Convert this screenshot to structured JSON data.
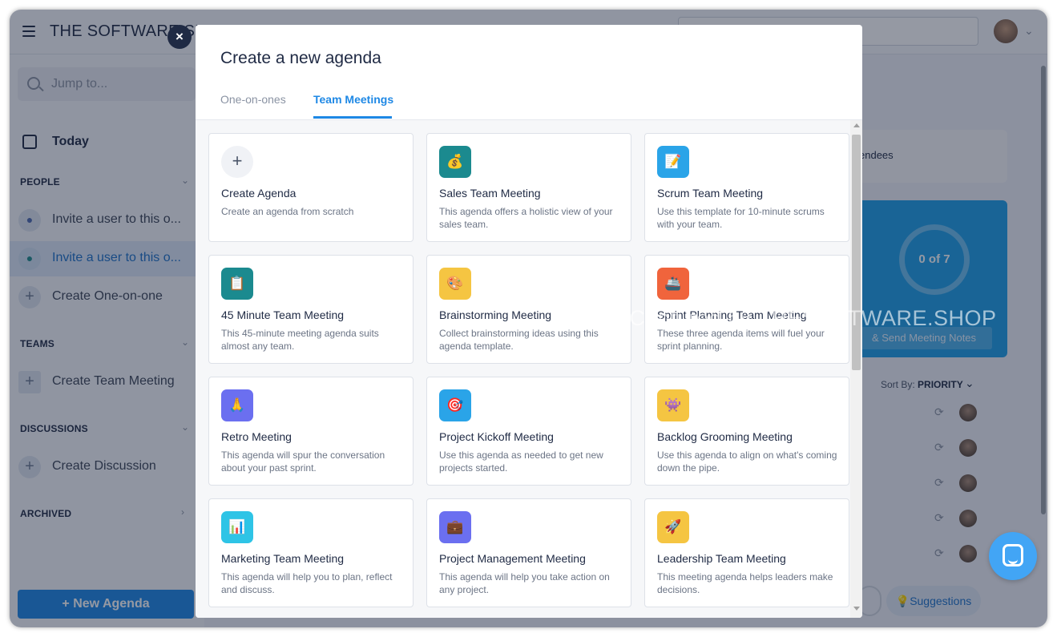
{
  "app": {
    "brand": "THE SOFTWARE SHO",
    "jump_placeholder": "Jump to...",
    "today": "Today",
    "sections": {
      "people": "PEOPLE",
      "teams": "TEAMS",
      "discussions": "DISCUSSIONS",
      "archived": "ARCHIVED"
    },
    "people_items": [
      "Invite a user to this o...",
      "Invite a user to this o..."
    ],
    "create_one_on_one": "Create One-on-one",
    "create_team_meeting": "Create Team Meeting",
    "create_discussion": "Create Discussion",
    "new_agenda": "New Agenda",
    "attendees": "endees",
    "progress": "0 of 7",
    "send_notes": "& Send Meeting Notes",
    "sort_by_label": "Sort By:",
    "sort_by_value": "PRIORITY",
    "suggestions": "Suggestions"
  },
  "modal": {
    "title": "Create a new agenda",
    "close": "×",
    "tabs": [
      {
        "label": "One-on-ones",
        "active": false
      },
      {
        "label": "Team Meetings",
        "active": true
      }
    ],
    "templates": [
      {
        "title": "Create Agenda",
        "desc": "Create an agenda from scratch",
        "icon": "plus-icon",
        "glyph": "+",
        "color": "#f0f2f6"
      },
      {
        "title": "Sales Team Meeting",
        "desc": "This agenda offers a holistic view of your sales team.",
        "icon": "money-bag-icon",
        "glyph": "💰",
        "color": "#1b8a8f"
      },
      {
        "title": "Scrum Team Meeting",
        "desc": "Use this template for 10-minute scrums with your team.",
        "icon": "memo-icon",
        "glyph": "📝",
        "color": "#2aa4e8"
      },
      {
        "title": "45 Minute Team Meeting",
        "desc": "This 45-minute meeting agenda suits almost any team.",
        "icon": "clipboard-icon",
        "glyph": "📋",
        "color": "#1b8a8f"
      },
      {
        "title": "Brainstorming Meeting",
        "desc": "Collect brainstorming ideas using this agenda template.",
        "icon": "palette-icon",
        "glyph": "🎨",
        "color": "#f5c542"
      },
      {
        "title": "Sprint Planning Team Meeting",
        "desc": "These three agenda items will fuel your sprint planning.",
        "icon": "ship-icon",
        "glyph": "🚢",
        "color": "#f0643c"
      },
      {
        "title": "Retro Meeting",
        "desc": "This agenda will spur the conversation about your past sprint.",
        "icon": "pray-icon",
        "glyph": "🙏",
        "color": "#6b6ff0"
      },
      {
        "title": "Project Kickoff Meeting",
        "desc": "Use this agenda as needed to get new projects started.",
        "icon": "target-icon",
        "glyph": "🎯",
        "color": "#2aa4e8"
      },
      {
        "title": "Backlog Grooming Meeting",
        "desc": "Use this agenda to align on what's coming down the pipe.",
        "icon": "alien-monster-icon",
        "glyph": "👾",
        "color": "#f5c542"
      },
      {
        "title": "Marketing Team Meeting",
        "desc": "This agenda will help you to plan, reflect and discuss.",
        "icon": "bar-chart-icon",
        "glyph": "📊",
        "color": "#2ec4e6"
      },
      {
        "title": "Project Management Meeting",
        "desc": "This agenda will help you take action on any project.",
        "icon": "briefcase-icon",
        "glyph": "💼",
        "color": "#6b6ff0"
      },
      {
        "title": "Leadership Team Meeting",
        "desc": "This meeting agenda helps leaders make decisions.",
        "icon": "rocket-icon",
        "glyph": "🚀",
        "color": "#f5c542"
      }
    ]
  },
  "watermark": "© Captured by THESOFTWARE.SHOP",
  "colors": {
    "accent": "#1e88e5",
    "overlay": "rgba(20,28,50,.45)"
  }
}
